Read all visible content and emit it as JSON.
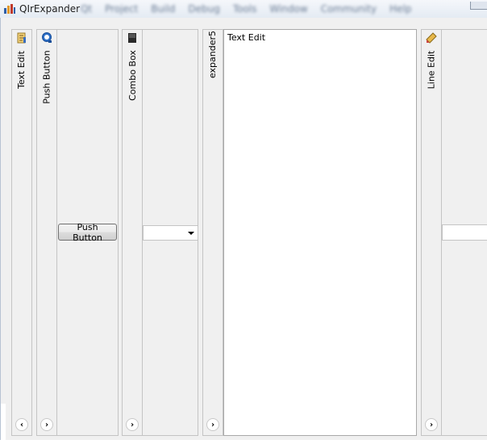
{
  "window": {
    "title": "QIrExpander",
    "background_menu": [
      "Qt",
      "Project",
      "Build",
      "Debug",
      "Tools",
      "Window",
      "Community",
      "Help"
    ]
  },
  "expanders": [
    {
      "label": "Text Edit",
      "icon": "text-edit-icon",
      "toggle": "‹"
    },
    {
      "label": "Push Button",
      "icon": "push-button-icon",
      "toggle": "›"
    },
    {
      "label": "Combo Box",
      "icon": "combo-box-icon",
      "toggle": "›"
    },
    {
      "label": "expander5",
      "icon": "",
      "toggle": "›"
    },
    {
      "label": "Line Edit",
      "icon": "line-edit-icon",
      "toggle": "›"
    }
  ],
  "content": {
    "push_button_label": "Push Button",
    "text_edit_value": "Text Edit",
    "combo_value": "",
    "line_edit_value": ""
  },
  "colors": {
    "panel_bg": "#f0f0f0",
    "border": "#c4c4c4",
    "titlebar": "#e4ebf3"
  }
}
